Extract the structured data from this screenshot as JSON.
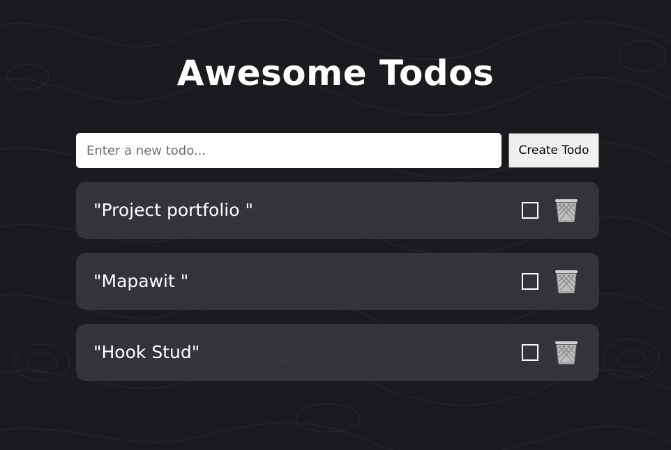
{
  "app": {
    "title": "Awesome Todos"
  },
  "form": {
    "input_placeholder": "Enter a new todo...",
    "input_value": "",
    "create_label": "Create Todo"
  },
  "todos": [
    {
      "text": "\"Project portfolio \"",
      "done": false
    },
    {
      "text": "\"Mapawit \"",
      "done": false
    },
    {
      "text": "\"Hook Stud\"",
      "done": false
    }
  ],
  "icons": {
    "complete": "checkbox-icon",
    "delete": "trash-icon"
  },
  "colors": {
    "background": "#1c1a1e",
    "card": "#3a383d",
    "text": "#ffffff"
  }
}
